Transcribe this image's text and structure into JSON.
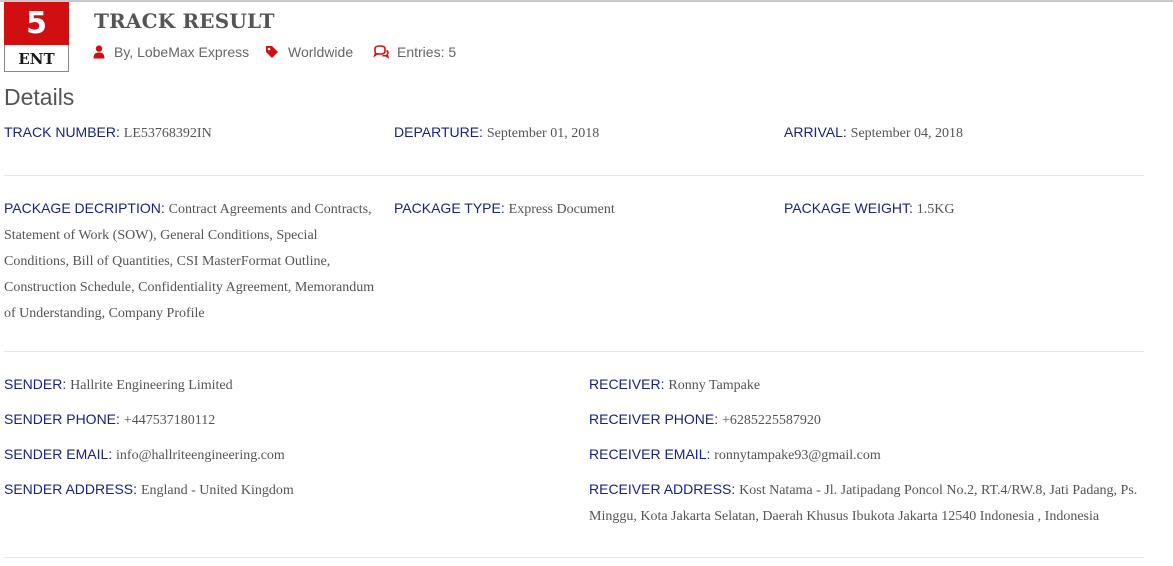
{
  "badge": {
    "number": "5",
    "label": "ENT"
  },
  "header": {
    "title": "TRACK RESULT",
    "author": "By, LobeMax Express",
    "category": "Worldwide",
    "entries": "Entries: 5"
  },
  "icons": {
    "author": "user-icon",
    "category": "tag-icon",
    "entries": "comments-icon"
  },
  "colors": {
    "accent": "#d10f10",
    "label": "#1a237e",
    "value": "#555555"
  },
  "details": {
    "heading": "Details",
    "track_number": {
      "label": "TRACK NUMBER:",
      "value": "LE53768392IN"
    },
    "departure": {
      "label": "DEPARTURE:",
      "value": "September 01, 2018"
    },
    "arrival": {
      "label": "ARRIVAL:",
      "value": "September 04, 2018"
    },
    "package_description": {
      "label": "PACKAGE DECRIPTION:",
      "value": "Contract Agreements and Contracts, Statement of Work (SOW), General Conditions, Special Conditions, Bill of Quantities, CSI MasterFormat Outline, Construction Schedule, Confidentiality Agreement, Memorandum of Understanding, Company Profile"
    },
    "package_type": {
      "label": "PACKAGE TYPE:",
      "value": "Express Document"
    },
    "package_weight": {
      "label": "PACKAGE WEIGHT:",
      "value": "1.5KG"
    }
  },
  "sender": {
    "name": {
      "label": "SENDER:",
      "value": "Hallrite Engineering Limited"
    },
    "phone": {
      "label": "SENDER PHONE:",
      "value": "+447537180112"
    },
    "email": {
      "label": "SENDER EMAIL:",
      "value": "info@hallriteengineering.com"
    },
    "address": {
      "label": "SENDER ADDRESS:",
      "value": "England - United Kingdom"
    }
  },
  "receiver": {
    "name": {
      "label": "RECEIVER:",
      "value": "Ronny Tampake"
    },
    "phone": {
      "label": "RECEIVER PHONE:",
      "value": "+6285225587920"
    },
    "email": {
      "label": "RECEIVER EMAIL:",
      "value": "ronnytampake93@gmail.com"
    },
    "address": {
      "label": "RECEIVER ADDRESS:",
      "value": "Kost Natama - Jl. Jatipadang Poncol No.2, RT.4/RW.8, Jati Padang, Ps. Minggu, Kota Jakarta Selatan, Daerah Khusus Ibukota Jakarta 12540 Indonesia , Indonesia"
    }
  }
}
